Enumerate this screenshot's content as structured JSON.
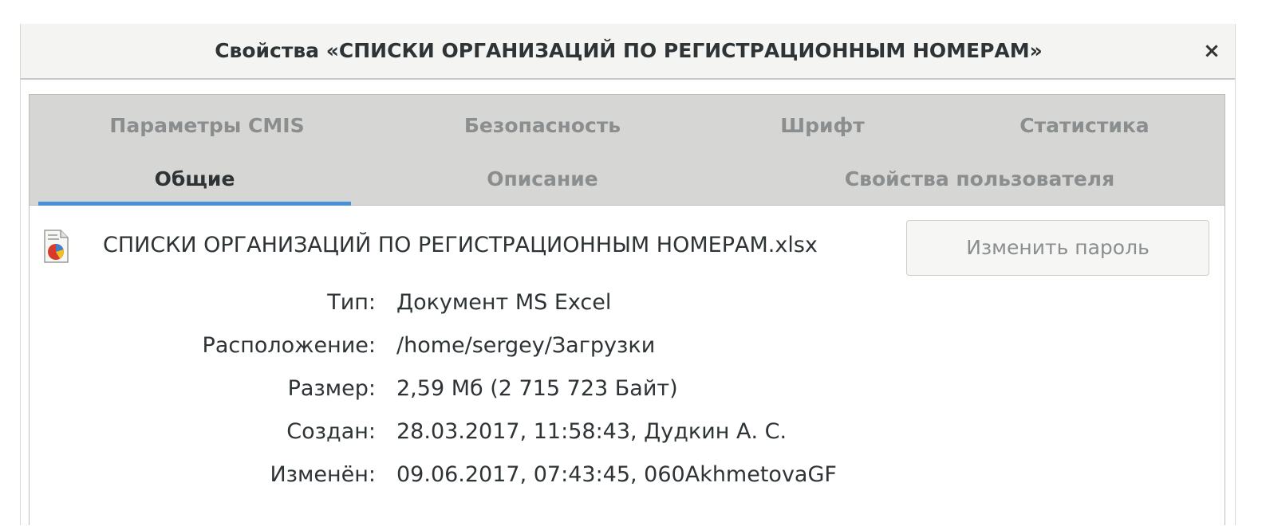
{
  "window": {
    "title": "Свойства «СПИСКИ ОРГАНИЗАЦИЙ ПО РЕГИСТРАЦИОННЫМ НОМЕРАМ»",
    "close_label": "×"
  },
  "tabs": {
    "row1": [
      "Параметры CMIS",
      "Безопасность",
      "Шрифт",
      "Статистика"
    ],
    "row2": [
      "Общие",
      "Описание",
      "Свойства пользователя"
    ],
    "active": "Общие"
  },
  "file": {
    "icon": "spreadsheet-file-icon",
    "name": "СПИСКИ ОРГАНИЗАЦИЙ ПО РЕГИСТРАЦИОННЫМ НОМЕРАМ.xlsx"
  },
  "buttons": {
    "change_password": "Изменить пароль"
  },
  "properties": [
    {
      "label": "Тип:",
      "value": "Документ MS Excel"
    },
    {
      "label": "Расположение:",
      "value": "/home/sergey/Загрузки"
    },
    {
      "label": "Размер:",
      "value": "2,59 Мб (2 715 723 Байт)"
    },
    {
      "label": "Создан:",
      "value": "28.03.2017, 11:58:43, Дудкин А. С."
    },
    {
      "label": "Изменён:",
      "value": "09.06.2017, 07:43:45, 060AkhmetovaGF"
    }
  ],
  "colors": {
    "accent": "#4a90d9",
    "tabbar_bg": "#d6d6d4",
    "inactive_text": "#8b8e8f",
    "text": "#2e3436"
  }
}
